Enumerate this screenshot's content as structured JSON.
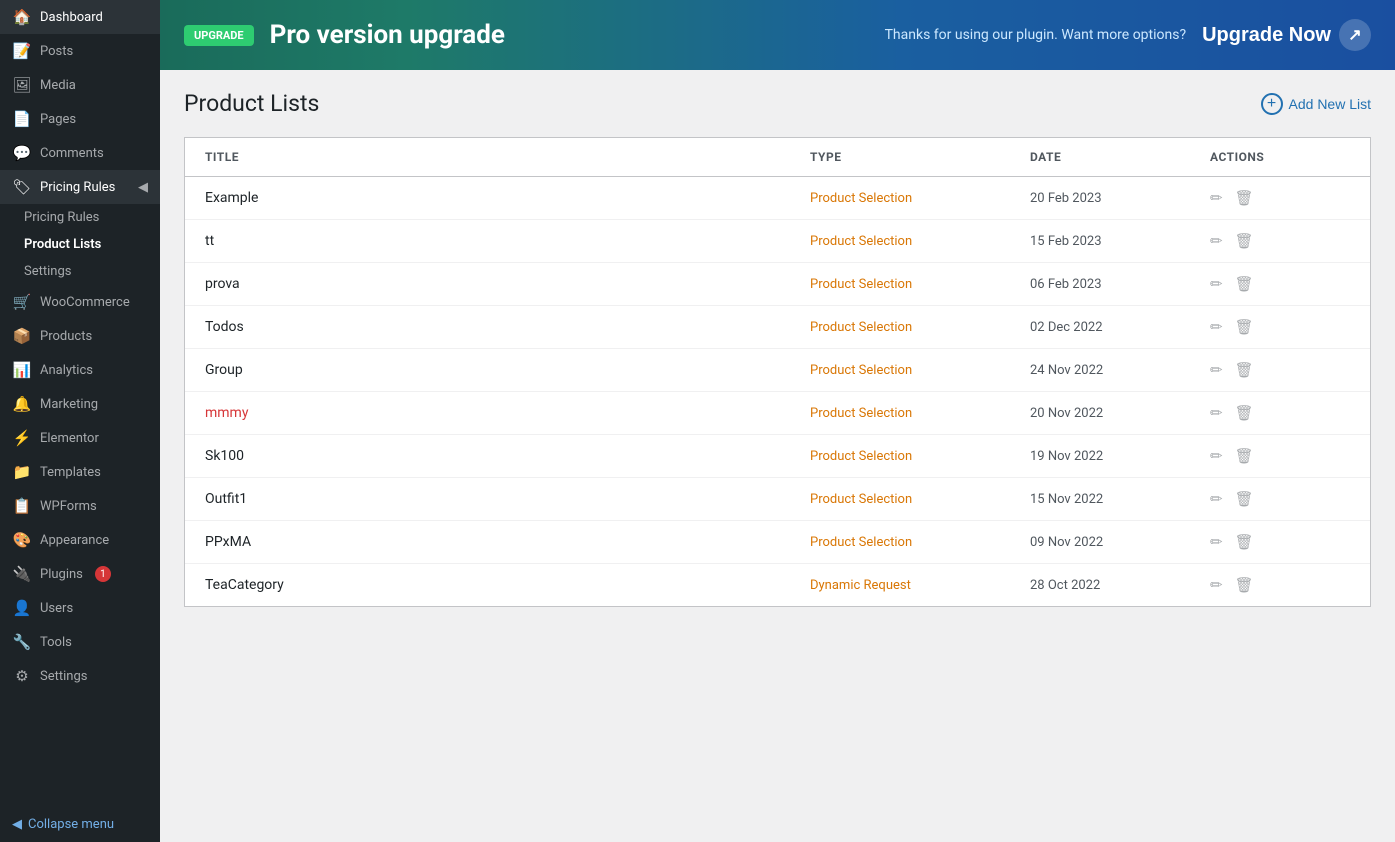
{
  "sidebar": {
    "items": [
      {
        "id": "dashboard",
        "label": "Dashboard",
        "icon": "🏠"
      },
      {
        "id": "posts",
        "label": "Posts",
        "icon": "📝"
      },
      {
        "id": "media",
        "label": "Media",
        "icon": "🖼"
      },
      {
        "id": "pages",
        "label": "Pages",
        "icon": "📄"
      },
      {
        "id": "comments",
        "label": "Comments",
        "icon": "💬"
      },
      {
        "id": "pricing-rules",
        "label": "Pricing Rules",
        "icon": "🏷",
        "active": true
      },
      {
        "id": "woocommerce",
        "label": "WooCommerce",
        "icon": "🛒"
      },
      {
        "id": "products",
        "label": "Products",
        "icon": "📦"
      },
      {
        "id": "analytics",
        "label": "Analytics",
        "icon": "📊"
      },
      {
        "id": "marketing",
        "label": "Marketing",
        "icon": "🔔"
      },
      {
        "id": "elementor",
        "label": "Elementor",
        "icon": "⚡"
      },
      {
        "id": "templates",
        "label": "Templates",
        "icon": "📁"
      },
      {
        "id": "wpforms",
        "label": "WPForms",
        "icon": "📋"
      },
      {
        "id": "appearance",
        "label": "Appearance",
        "icon": "🎨"
      },
      {
        "id": "plugins",
        "label": "Plugins",
        "icon": "🔌",
        "badge": "1"
      },
      {
        "id": "users",
        "label": "Users",
        "icon": "👤"
      },
      {
        "id": "tools",
        "label": "Tools",
        "icon": "🔧"
      },
      {
        "id": "settings",
        "label": "Settings",
        "icon": "⚙"
      }
    ],
    "sub_items": [
      {
        "id": "pricing-rules-sub",
        "label": "Pricing Rules",
        "parent": "pricing-rules"
      },
      {
        "id": "product-lists",
        "label": "Product Lists",
        "parent": "pricing-rules",
        "active": true
      },
      {
        "id": "settings-sub",
        "label": "Settings",
        "parent": "pricing-rules"
      }
    ],
    "collapse_label": "Collapse menu"
  },
  "banner": {
    "badge": "UPGRADE",
    "title": "Pro version upgrade",
    "subtitle": "Thanks for using our plugin. Want more options?",
    "cta": "Upgrade Now"
  },
  "page": {
    "title": "Product Lists",
    "add_new_label": "Add New List"
  },
  "table": {
    "columns": [
      "TITLE",
      "TYPE",
      "DATE",
      "ACTIONS"
    ],
    "rows": [
      {
        "title": "Example",
        "type": "Product Selection",
        "date": "20 Feb 2023",
        "title_link": false
      },
      {
        "title": "tt",
        "type": "Product Selection",
        "date": "15 Feb 2023",
        "title_link": false
      },
      {
        "title": "prova",
        "type": "Product Selection",
        "date": "06 Feb 2023",
        "title_link": false
      },
      {
        "title": "Todos",
        "type": "Product Selection",
        "date": "02 Dec 2022",
        "title_link": false
      },
      {
        "title": "Group",
        "type": "Product Selection",
        "date": "24 Nov 2022",
        "title_link": false
      },
      {
        "title": "mmmy",
        "type": "Product Selection",
        "date": "20 Nov 2022",
        "title_link": true
      },
      {
        "title": "Sk100",
        "type": "Product Selection",
        "date": "19 Nov 2022",
        "title_link": false
      },
      {
        "title": "Outfit1",
        "type": "Product Selection",
        "date": "15 Nov 2022",
        "title_link": false
      },
      {
        "title": "PPxMA",
        "type": "Product Selection",
        "date": "09 Nov 2022",
        "title_link": false
      },
      {
        "title": "TeaCategory",
        "type": "Dynamic Request",
        "date": "28 Oct 2022",
        "title_link": false
      }
    ]
  }
}
